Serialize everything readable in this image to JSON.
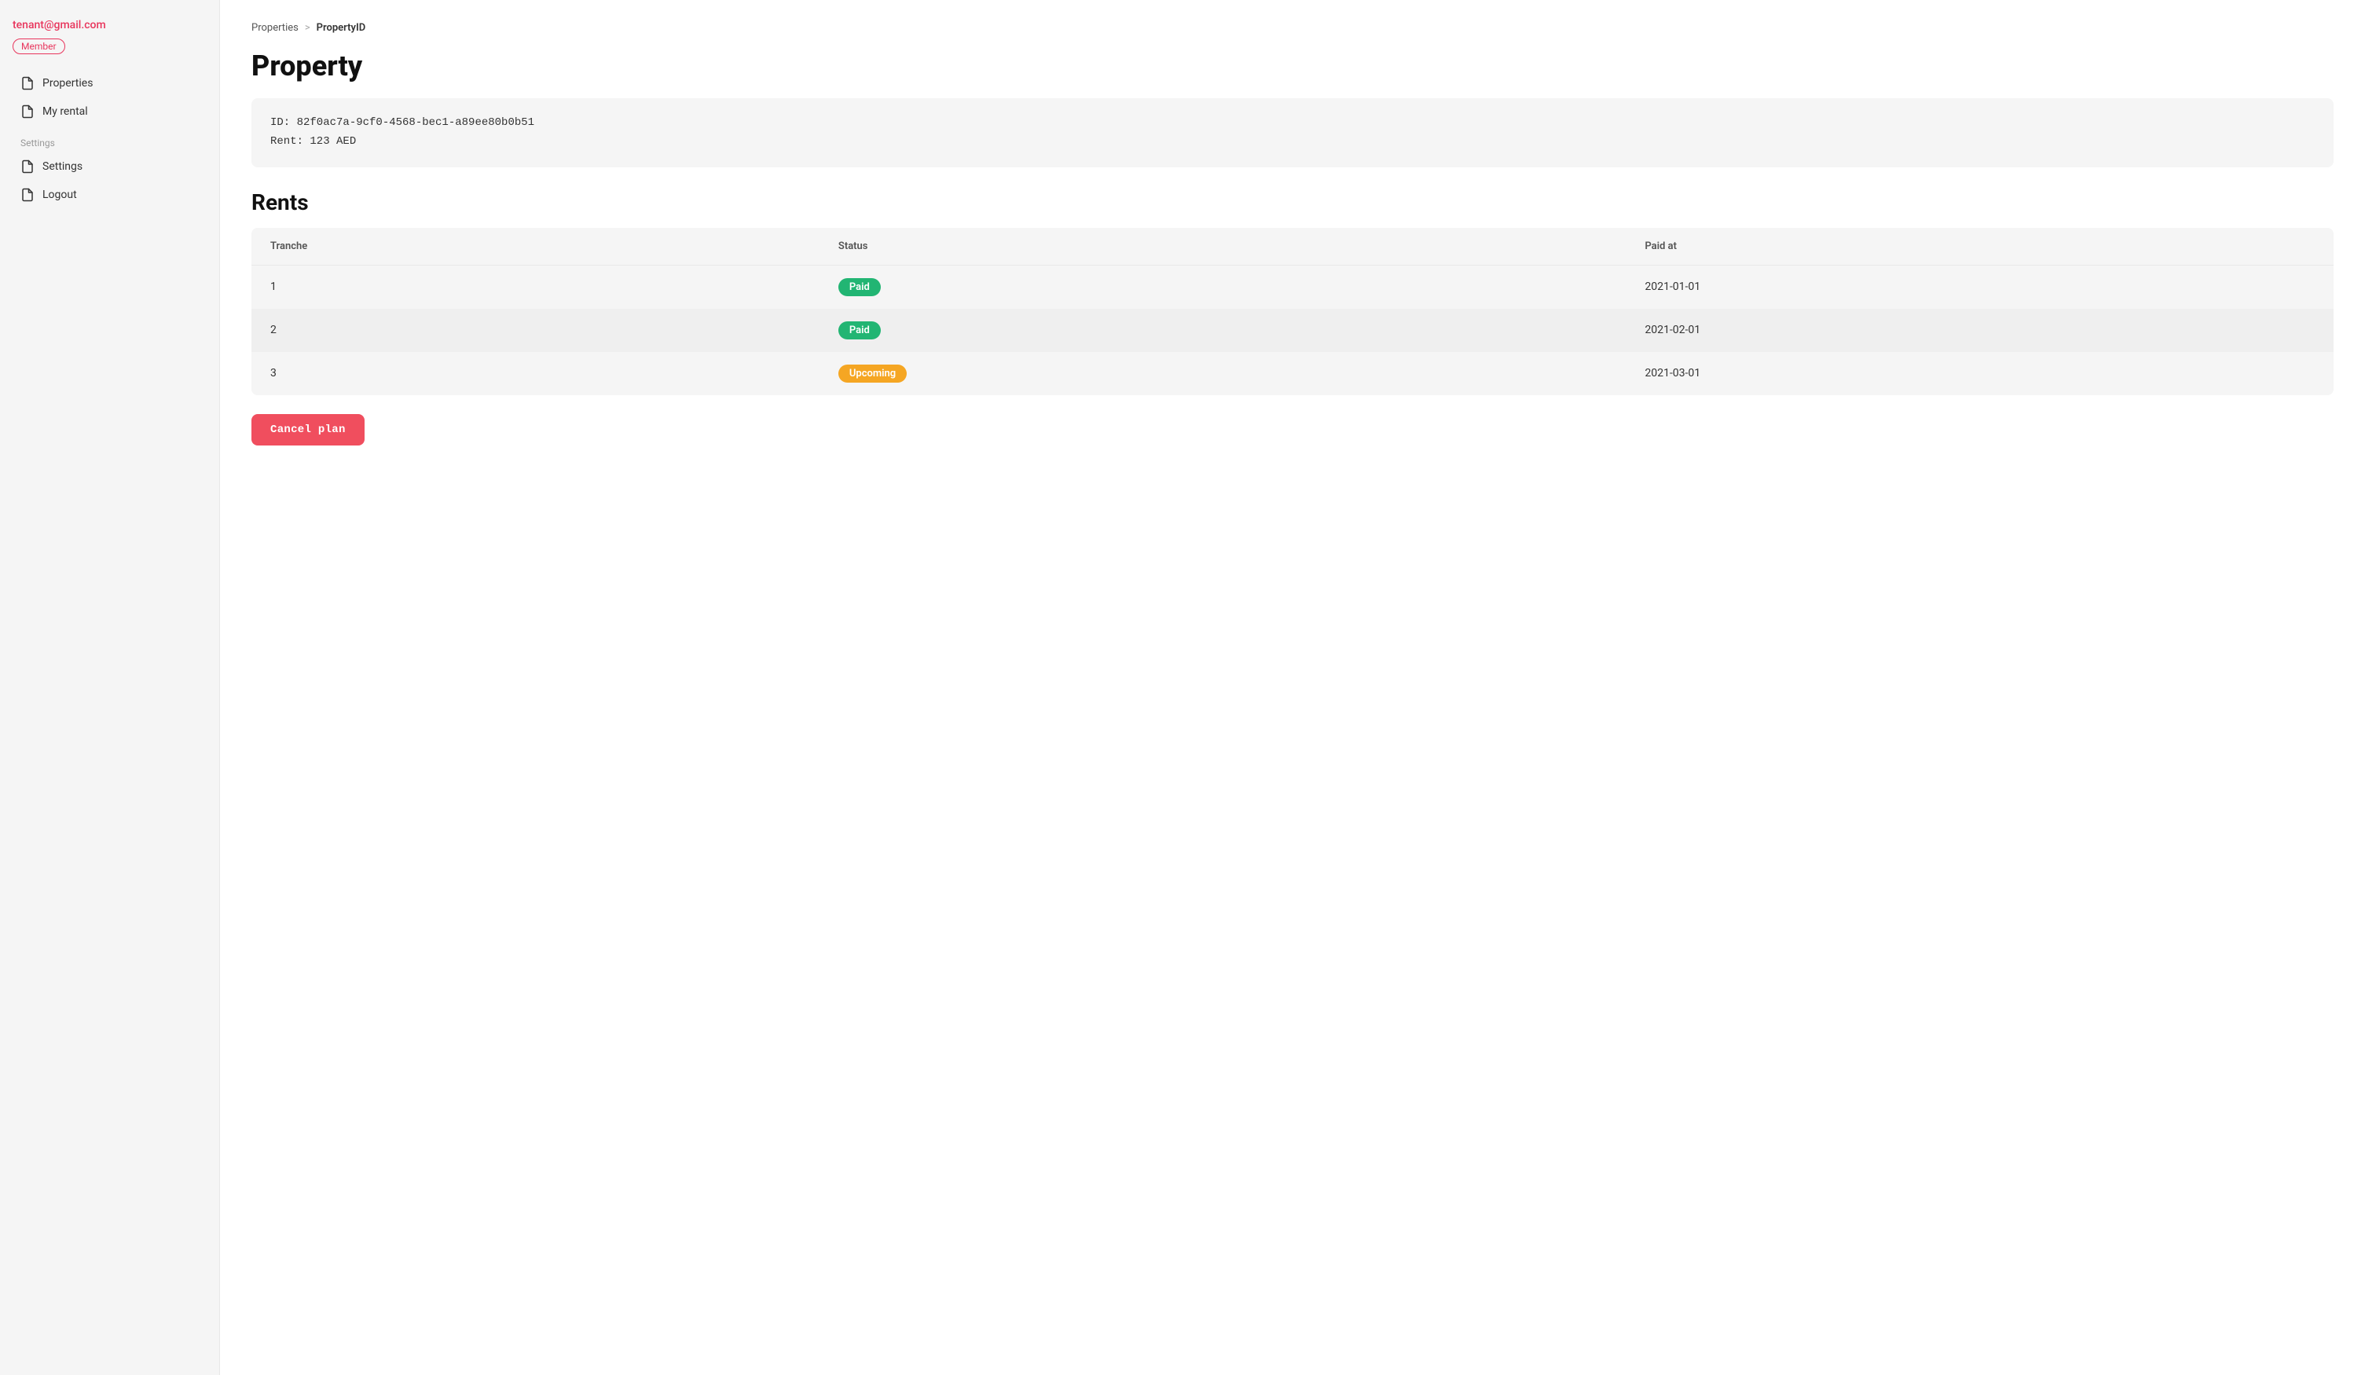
{
  "sidebar": {
    "email": "tenant@gmail.com",
    "badge_label": "Member",
    "nav_items": [
      {
        "id": "properties",
        "label": "Properties"
      },
      {
        "id": "my-rental",
        "label": "My rental"
      }
    ],
    "settings_label": "Settings",
    "settings_items": [
      {
        "id": "settings",
        "label": "Settings"
      },
      {
        "id": "logout",
        "label": "Logout"
      }
    ]
  },
  "breadcrumb": {
    "parent": "Properties",
    "separator": ">",
    "current": "PropertyID"
  },
  "page_title": "Property",
  "property_info": {
    "id_label": "ID: 82f0ac7a-9cf0-4568-bec1-a89ee80b0b51",
    "rent_label": "Rent: 123 AED"
  },
  "rents_section": {
    "title": "Rents",
    "table_headers": {
      "tranche": "Tranche",
      "status": "Status",
      "paid_at": "Paid at"
    },
    "rows": [
      {
        "tranche": "1",
        "status": "Paid",
        "status_type": "paid",
        "paid_at": "2021-01-01"
      },
      {
        "tranche": "2",
        "status": "Paid",
        "status_type": "paid",
        "paid_at": "2021-02-01"
      },
      {
        "tranche": "3",
        "status": "Upcoming",
        "status_type": "upcoming",
        "paid_at": "2021-03-01"
      }
    ]
  },
  "cancel_button_label": "Cancel plan",
  "icons": {
    "doc": "🗋"
  }
}
